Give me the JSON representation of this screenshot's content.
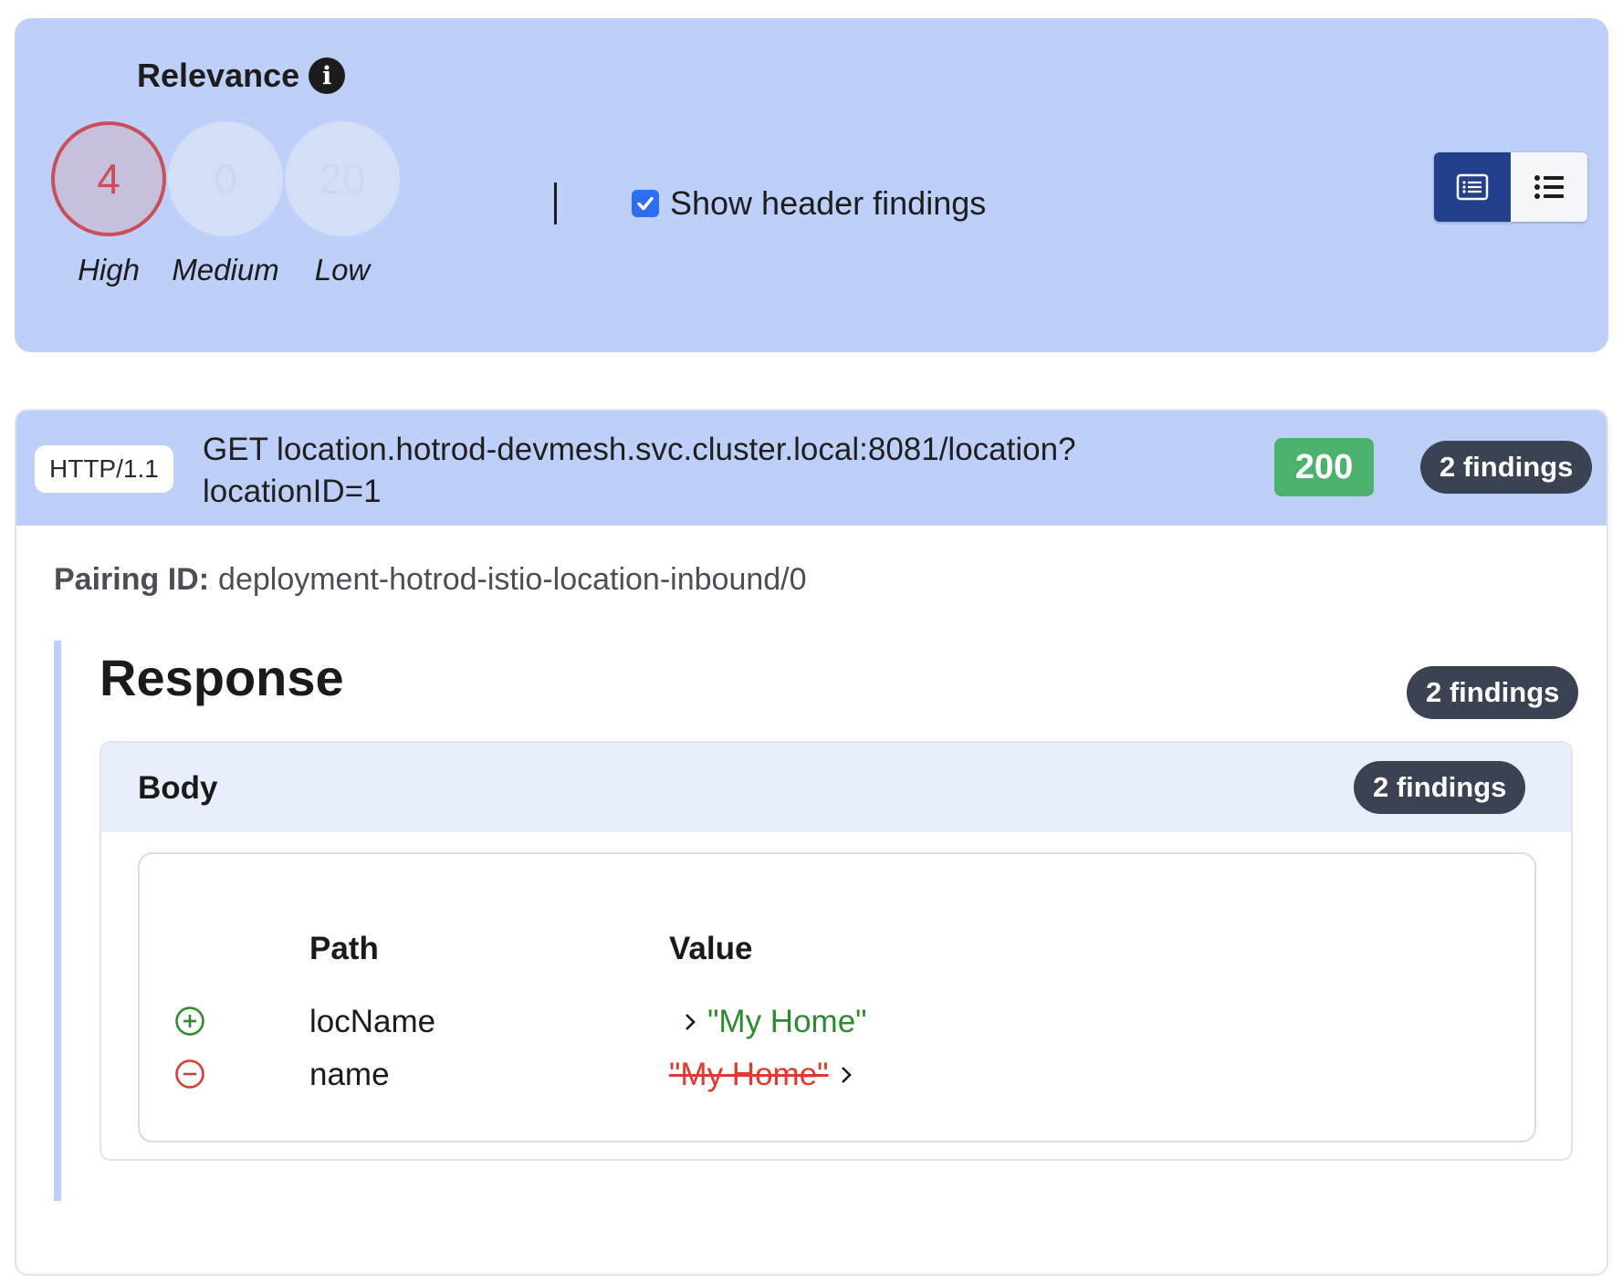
{
  "relevance": {
    "title": "Relevance",
    "info_icon": "info-icon",
    "levels": [
      {
        "count": "4",
        "label": "High",
        "active": true,
        "color": "#c64f5a"
      },
      {
        "count": "0",
        "label": "Medium",
        "active": false
      },
      {
        "count": "20",
        "label": "Low",
        "active": false
      }
    ],
    "show_header_findings": {
      "label": "Show header findings",
      "checked": true
    },
    "view_modes": [
      {
        "icon": "detail-list-icon",
        "selected": true
      },
      {
        "icon": "bullet-list-icon",
        "selected": false
      }
    ],
    "panel_color": "#bed0f9"
  },
  "request": {
    "protocol": "HTTP/1.1",
    "line1": "GET location.hotrod-devmesh.svc.cluster.local:8081/location?",
    "line2": "locationID=1",
    "status": "200",
    "status_color": "#4eb26f",
    "findings": "2 findings",
    "pairing_label": "Pairing ID:",
    "pairing_value": "deployment-hotrod-istio-location-inbound/0"
  },
  "response": {
    "title": "Response",
    "findings": "2 findings",
    "body": {
      "title": "Body",
      "findings": "2 findings",
      "columns": {
        "path": "Path",
        "value": "Value"
      },
      "rows": [
        {
          "change": "added",
          "icon": "plus-circle-icon",
          "path": "locName",
          "value": "\"My Home\""
        },
        {
          "change": "removed",
          "icon": "minus-circle-icon",
          "path": "name",
          "value": "\"My Home\""
        }
      ]
    }
  }
}
